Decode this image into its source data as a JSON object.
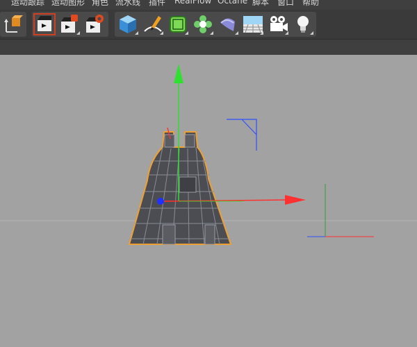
{
  "menu": {
    "items": [
      {
        "label": "运动跟踪"
      },
      {
        "label": "运动图形"
      },
      {
        "label": "角色"
      },
      {
        "label": "流水线"
      },
      {
        "label": "插件"
      },
      {
        "label": "RealFlow"
      },
      {
        "label": "Octane"
      },
      {
        "label": "脚本"
      },
      {
        "label": "窗口"
      },
      {
        "label": "帮助"
      }
    ]
  },
  "toolbar": {
    "tools": [
      {
        "name": "coordinate-system-icon"
      },
      {
        "name": "render-view-icon"
      },
      {
        "name": "render-to-picture-viewer-icon"
      },
      {
        "name": "render-settings-icon"
      },
      {
        "name": "cube-icon"
      },
      {
        "name": "pen-spline-icon"
      },
      {
        "name": "subdivision-surface-icon"
      },
      {
        "name": "cloner-icon"
      },
      {
        "name": "deformer-icon"
      },
      {
        "name": "floor-icon"
      },
      {
        "name": "camera-icon"
      },
      {
        "name": "light-icon"
      }
    ]
  },
  "colors": {
    "menubar_bg": "#3f3f3f",
    "toolbar_bg": "#3a3a3a",
    "viewport_bg": "#a2a2a2",
    "selection_outline": "#f0a030",
    "axis_x": "#ff3030",
    "axis_y": "#30e030",
    "axis_z": "#3050ff"
  }
}
